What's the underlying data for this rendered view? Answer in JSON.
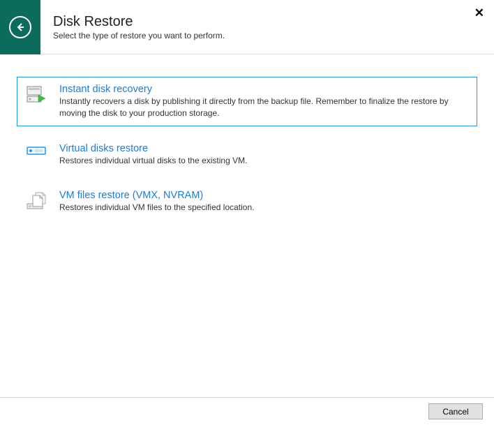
{
  "colors": {
    "header_bg": "#0b6b5d",
    "link": "#1c7cd6",
    "selected_border": "#1c97ea"
  },
  "header": {
    "title": "Disk Restore",
    "subtitle": "Select the type of restore you want to perform."
  },
  "options": [
    {
      "title": "Instant disk recovery",
      "description": "Instantly recovers a disk by publishing it directly from the backup file. Remember to finalize the restore by moving the disk to your production storage.",
      "selected": true,
      "icon": "disk-play-icon"
    },
    {
      "title": "Virtual disks restore",
      "description": "Restores individual virtual disks to the existing VM.",
      "selected": false,
      "icon": "disk-icon"
    },
    {
      "title": "VM files restore (VMX, NVRAM)",
      "description": "Restores individual VM files to the specified location.",
      "selected": false,
      "icon": "files-icon"
    }
  ],
  "footer": {
    "cancel_label": "Cancel"
  }
}
